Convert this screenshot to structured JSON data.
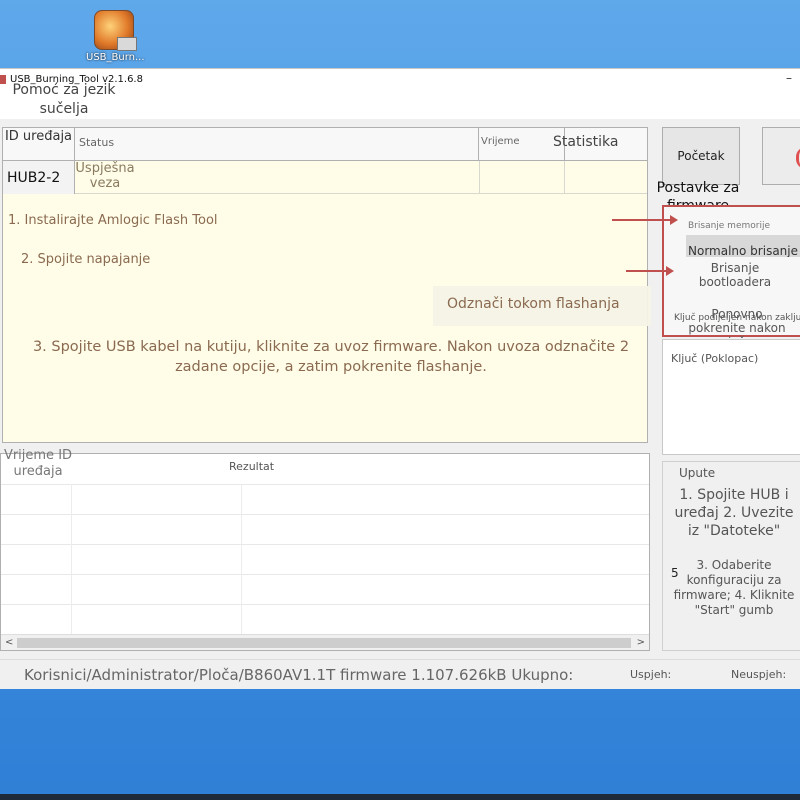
{
  "desktop": {
    "icon_label": "USB_Burn..."
  },
  "window": {
    "title": "USB_Burning_Tool v2.1.6.8",
    "min_glyph": "–"
  },
  "menu": {
    "help": "Pomoć za jezik sučelja"
  },
  "grid": {
    "col_id": "ID uređaja",
    "col_status": "Status",
    "col_time": "Vrijeme",
    "col_stat": "Statistika",
    "device": "HUB2-2",
    "status": "Uspješna veza",
    "steps": [
      "1. Instalirajte Amlogic Flash Tool",
      "2. Spojite napajanje",
      "3. Spojite USB kabel na kutiju, kliknite za uvoz firmware. Nakon uvoza odznačite 2 zadane opcije, a zatim pokrenite flashanje."
    ],
    "note": "Odznači tokom flashanja"
  },
  "log": {
    "col_time_id": "Vrijeme ID uređaja",
    "col_result": "Rezultat",
    "arrow_left": "<",
    "arrow_right": ">"
  },
  "statusbar": {
    "path": "Korisnici/Administrator/Ploča/B860AV1.1T firmware 1.107.626kB Ukupno:",
    "success": "Uspjeh:",
    "fail": "Neuspjeh:"
  },
  "right_panel": {
    "start_button": "Početak",
    "settings_title": "Postavke za firmware",
    "erase_memory": "Brisanje memorije",
    "erase_value": "Normalno brisanje",
    "erase_bootloader": "Brisanje bootloadera",
    "restart_after": "Ponovno pokrenite nakon uspješnog flashanja",
    "key_cut": "Ključ podijeljen nakon zaključavanja",
    "key_label": "Ključ (Poklopac)",
    "guide_title": "Upute",
    "guide_big": "1. Spojite HUB i uređaj 2. Uvezite iz \"Datoteke\"",
    "guide_small": "3. Odaberite konfiguraciju za firmware; 4. Kliknite \"Start\" gumb",
    "guide_num": "5"
  },
  "colors": {
    "accent_red": "#c0504d",
    "grid_bg": "#fffde8",
    "desktop_blue": "#3d8ee0"
  }
}
